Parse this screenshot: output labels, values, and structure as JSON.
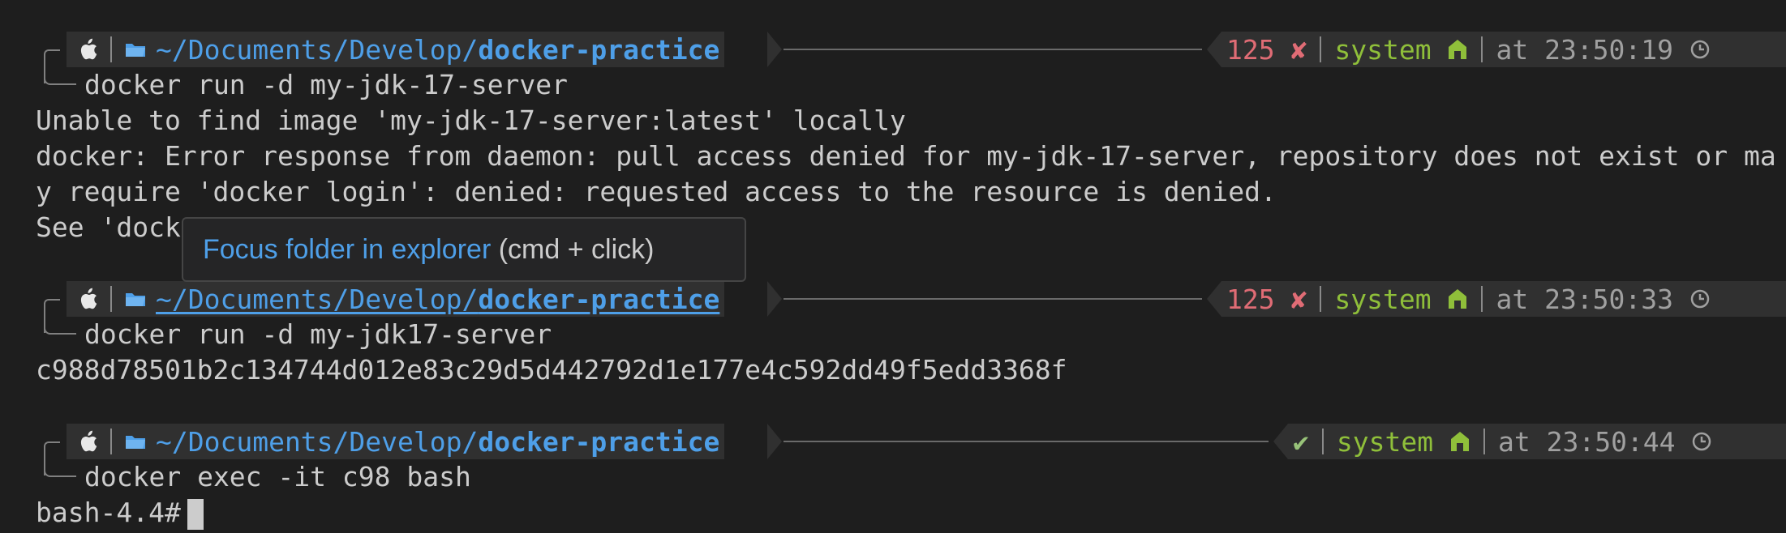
{
  "prompts": [
    {
      "path_dir": "~/Documents/Develop/",
      "path_repo": "docker-practice",
      "status_code": "125",
      "status_mark": "✘",
      "env": "system",
      "time_prefix": "at",
      "time": "23:50:19",
      "command": "docker run -d my-jdk-17-server"
    },
    {
      "path_dir": "~/Documents/Develop/",
      "path_repo": "docker-practice",
      "status_code": "125",
      "status_mark": "✘",
      "env": "system",
      "time_prefix": "at",
      "time": "23:50:33",
      "command": "docker run -d my-jdk17-server"
    },
    {
      "path_dir": "~/Documents/Develop/",
      "path_repo": "docker-practice",
      "status_code": "",
      "status_mark": "✔",
      "env": "system",
      "time_prefix": "at",
      "time": "23:50:44",
      "command": "docker exec -it c98 bash"
    }
  ],
  "output": {
    "line1": "Unable to find image 'my-jdk-17-server:latest' locally",
    "line2": "docker: Error response from daemon: pull access denied for my-jdk-17-server, repository does not exist or ma",
    "line3": "y require 'docker login': denied: requested access to the resource is denied.",
    "line4": "See 'dock",
    "line5": "c988d78501b2c134744d012e83c29d5d442792d1e177e4c592dd49f5edd3368f",
    "shell_prompt": "bash-4.4#"
  },
  "tooltip": {
    "link_text": "Focus folder in explorer",
    "hint_text": " (cmd + click)"
  },
  "icons": {
    "os": "apple-icon",
    "folder": "folder-icon",
    "env": "home-icon",
    "clock": "clock-icon"
  },
  "colors": {
    "background": "#1e1e1e",
    "segment": "#303030",
    "path": "#4e9fe8",
    "error": "#e06c75",
    "success": "#98c379",
    "env": "#8fbf3a"
  }
}
